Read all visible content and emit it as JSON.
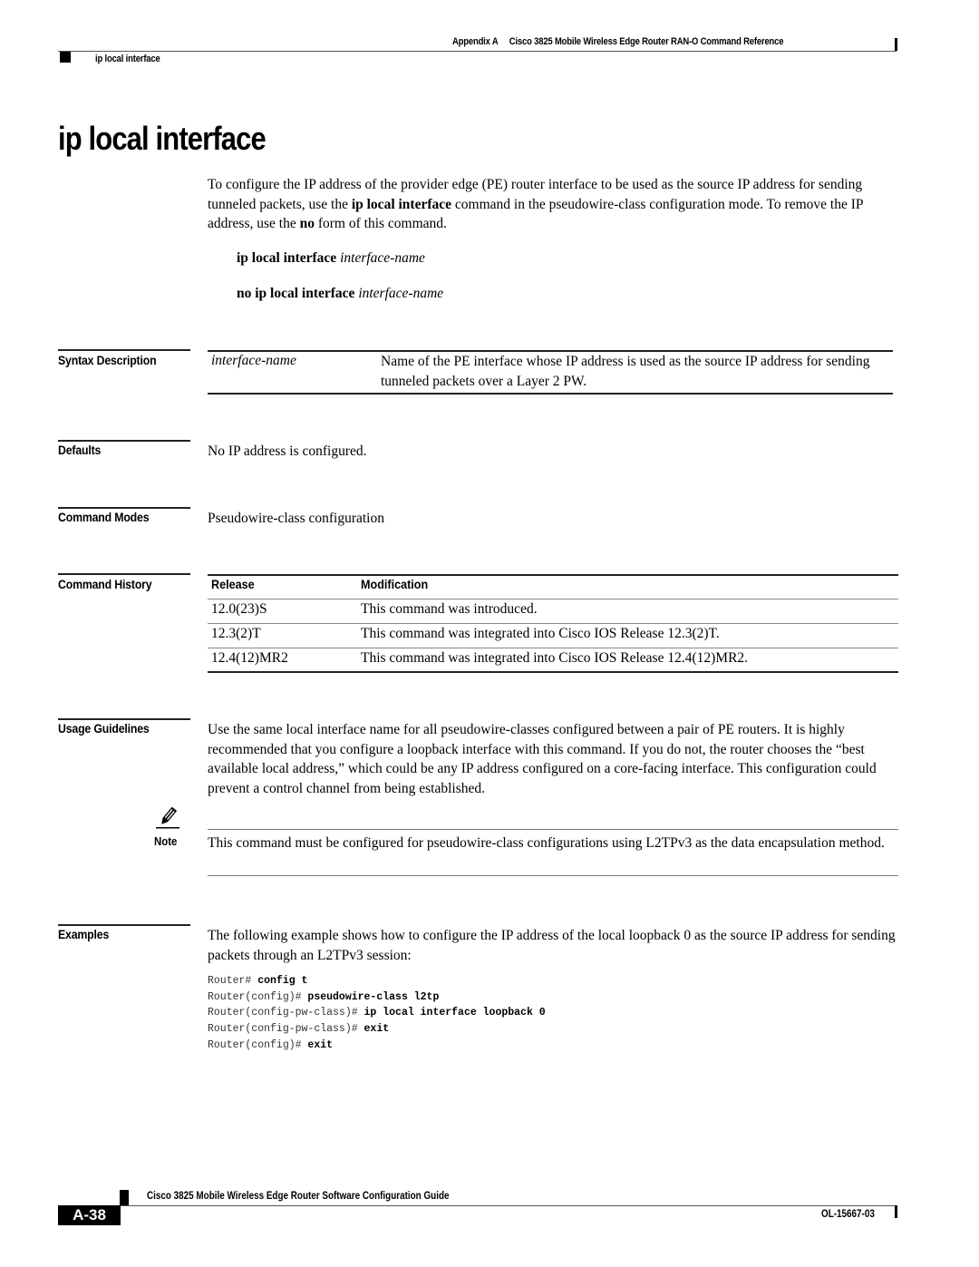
{
  "header": {
    "appendix_label": "Appendix A",
    "book_title": "Cisco 3825 Mobile Wireless Edge Router RAN-O Command Reference",
    "section_tag": "ip local interface"
  },
  "page_title": "ip local interface",
  "intro": {
    "text_1": "To configure the IP address of the provider edge (PE) router interface to be used as the source IP address for sending tunneled packets, use the ",
    "cmd_bold": "ip local interface",
    "text_2": " command in the pseudowire-class configuration mode. To remove the IP address, use the ",
    "no_bold": "no",
    "text_3": " form of this command."
  },
  "syntax": [
    {
      "keyword": "ip local interface",
      "argument": "interface-name"
    },
    {
      "keyword": "no ip local interface",
      "argument": "interface-name"
    }
  ],
  "sections": {
    "syntax_description": {
      "label": "Syntax Description",
      "rows": [
        {
          "param": "interface-name",
          "description": "Name of the PE interface whose IP address is used as the source IP address for sending tunneled packets over a Layer 2 PW."
        }
      ]
    },
    "defaults": {
      "label": "Defaults",
      "text": "No IP address is configured."
    },
    "command_modes": {
      "label": "Command Modes",
      "text": "Pseudowire-class configuration"
    },
    "command_history": {
      "label": "Command History",
      "columns": [
        "Release",
        "Modification"
      ],
      "rows": [
        {
          "release": "12.0(23)S",
          "modification": "This command was introduced."
        },
        {
          "release": "12.3(2)T",
          "modification": "This command was integrated into Cisco IOS Release 12.3(2)T."
        },
        {
          "release": "12.4(12)MR2",
          "modification": "This command was integrated into Cisco IOS Release 12.4(12)MR2."
        }
      ]
    },
    "usage_guidelines": {
      "label": "Usage Guidelines",
      "text": "Use the same local interface name for all pseudowire-classes configured between a pair of PE routers. It is highly recommended that you configure a loopback interface with this command. If you do not, the router chooses the “best available local address,” which could be any IP address configured on a core-facing interface. This configuration could prevent a control channel from being established.",
      "note": {
        "label": "Note",
        "icon": "pencil-icon",
        "text": "This command must be configured for pseudowire-class configurations using L2TPv3 as the data encapsulation method."
      }
    },
    "examples": {
      "label": "Examples",
      "text": "The following example shows how to configure the IP address of the local loopback 0 as the source IP address for sending packets through an L2TPv3 session:",
      "code": [
        {
          "prompt": "Router# ",
          "command": "config t"
        },
        {
          "prompt": "Router(config)# ",
          "command": "pseudowire-class l2tp"
        },
        {
          "prompt": "Router(config-pw-class)# ",
          "command": "ip local interface loopback 0"
        },
        {
          "prompt": "Router(config-pw-class)# ",
          "command": "exit"
        },
        {
          "prompt": "Router(config)# ",
          "command": "exit"
        }
      ]
    }
  },
  "footer": {
    "guide_title": "Cisco 3825 Mobile Wireless Edge Router Software Configuration Guide",
    "page_number": "A-38",
    "doc_number": "OL-15667-03"
  }
}
